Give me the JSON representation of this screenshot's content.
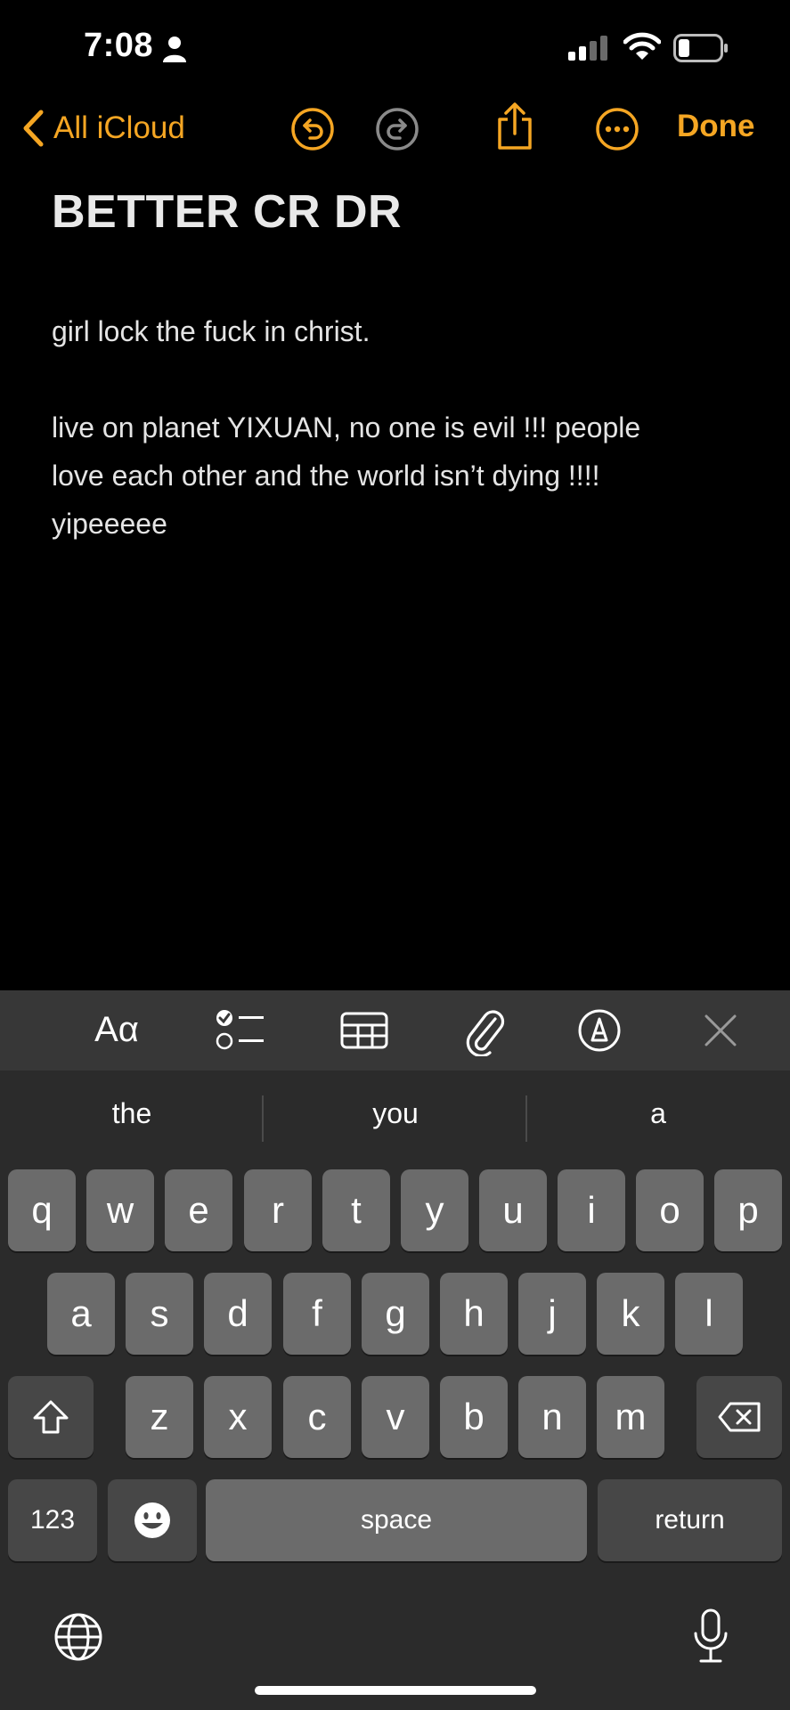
{
  "status": {
    "time": "7:08"
  },
  "nav": {
    "back_label": "All iCloud",
    "done_label": "Done"
  },
  "note": {
    "title": "BETTER CR DR",
    "lines": [
      "girl lock the fuck in christ.",
      "live on planet YIXUAN,  no one is evil !!! people",
      "love each other and the world isn’t dying !!!!",
      "yipeeeee"
    ]
  },
  "toolbar": {
    "format_label": "Aα"
  },
  "suggestions": [
    "the",
    "you",
    "a"
  ],
  "keys": {
    "row1": [
      "q",
      "w",
      "e",
      "r",
      "t",
      "y",
      "u",
      "i",
      "o",
      "p"
    ],
    "row2": [
      "a",
      "s",
      "d",
      "f",
      "g",
      "h",
      "j",
      "k",
      "l"
    ],
    "row3": [
      "z",
      "x",
      "c",
      "v",
      "b",
      "n",
      "m"
    ],
    "numbers_label": "123",
    "space_label": "space",
    "return_label": "return"
  },
  "colors": {
    "accent": "#f5a623",
    "background": "#000000",
    "keyboard": "#2b2b2b",
    "key": "#6b6b6b"
  }
}
